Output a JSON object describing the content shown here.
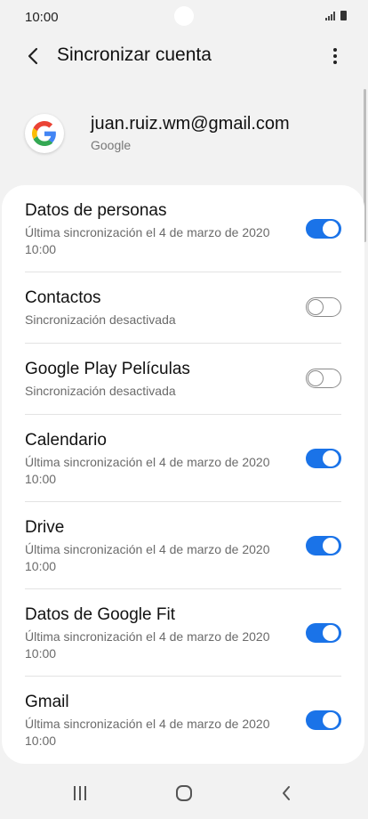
{
  "status_bar": {
    "time": "10:00"
  },
  "header": {
    "title": "Sincronizar cuenta",
    "back_icon": "chevron-left-icon",
    "more_icon": "more-vert-icon"
  },
  "account": {
    "email": "juan.ruiz.wm@gmail.com",
    "provider": "Google",
    "logo_icon": "google-logo-icon"
  },
  "colors": {
    "accent": "#1a73e8",
    "card_bg": "#ffffff",
    "page_bg": "#f2f2f2"
  },
  "sync_items": [
    {
      "title": "Datos de personas",
      "subtitle": "Última sincronización el 4 de marzo de 2020 10:00",
      "enabled": true
    },
    {
      "title": "Contactos",
      "subtitle": "Sincronización desactivada",
      "enabled": false
    },
    {
      "title": "Google Play Películas",
      "subtitle": "Sincronización desactivada",
      "enabled": false
    },
    {
      "title": "Calendario",
      "subtitle": "Última sincronización el 4 de marzo de 2020 10:00",
      "enabled": true
    },
    {
      "title": "Drive",
      "subtitle": "Última sincronización el 4 de marzo de 2020 10:00",
      "enabled": true
    },
    {
      "title": "Datos de Google Fit",
      "subtitle": "Última sincronización el 4 de marzo de 2020 10:00",
      "enabled": true
    },
    {
      "title": "Gmail",
      "subtitle": "Última sincronización el 4 de marzo de 2020 10:00",
      "enabled": true
    }
  ],
  "nav_bar": {
    "recents_icon": "recents-icon",
    "home_icon": "home-icon",
    "back_icon": "nav-back-icon"
  }
}
